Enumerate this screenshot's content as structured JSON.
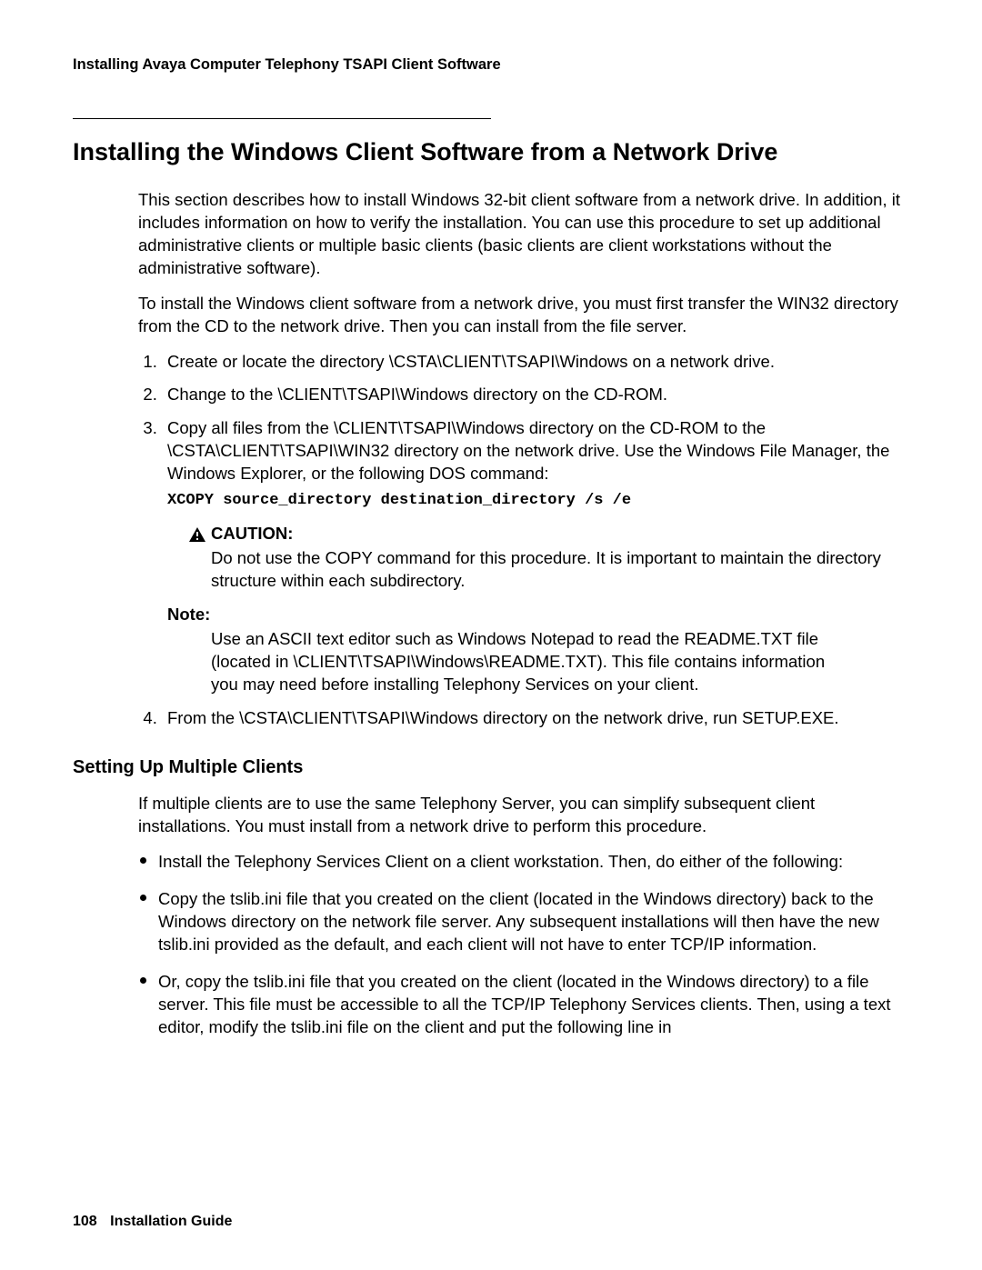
{
  "running_head": "Installing Avaya Computer Telephony TSAPI Client Software",
  "section_title": "Installing the Windows Client Software from a Network Drive",
  "intro_p1": "This section describes how to install Windows 32-bit client software from a network drive. In addition, it includes information on how to verify the installation. You can use this procedure to set up additional administrative clients or multiple basic clients (basic clients are client workstations without the administrative software).",
  "intro_p2": "To install the Windows client software from a network drive, you must first transfer the WIN32 directory from the CD to the network drive. Then you can install from the file server.",
  "steps": {
    "s1": "Create or locate the directory \\CSTA\\CLIENT\\TSAPI\\Windows on a network drive.",
    "s2": "Change to the \\CLIENT\\TSAPI\\Windows directory on the CD-ROM.",
    "s3": "Copy all files from the \\CLIENT\\TSAPI\\Windows directory on the CD-ROM to the \\CSTA\\CLIENT\\TSAPI\\WIN32 directory on the network drive. Use the Windows File Manager, the Windows Explorer, or the following DOS command:",
    "s3_code": "XCOPY source_directory destination_directory /s /e",
    "caution_label": "CAUTION:",
    "caution_body": "Do not use the COPY command for this procedure. It is important to maintain the directory structure within each subdirectory.",
    "note_label": "Note:",
    "note_body": "Use an ASCII text editor such as Windows Notepad to read the README.TXT file (located in \\CLIENT\\TSAPI\\Windows\\README.TXT). This file contains information you may need before installing Telephony Services on your client.",
    "s4": "From the \\CSTA\\CLIENT\\TSAPI\\Windows directory on the network drive, run SETUP.EXE."
  },
  "subsection_title": "Setting Up Multiple Clients",
  "sub_p1": "If multiple clients are to use the same Telephony Server, you can simplify subsequent client installations. You must install from a network drive to perform this procedure.",
  "bullets": {
    "b1": "Install the Telephony Services Client on a client workstation. Then, do either of the following:",
    "b2": "Copy the tslib.ini file that you created on the client (located in the Windows directory) back to the Windows directory on the network file server. Any subsequent installations will then have the new tslib.ini provided as the default, and each client will not have to enter TCP/IP information.",
    "b3": "Or, copy the tslib.ini file that you created on the client (located in the Windows directory) to a file server. This file must be accessible to all the TCP/IP Telephony Services clients. Then, using a text editor, modify the tslib.ini file on the client and put the following line in"
  },
  "footer": {
    "page_number": "108",
    "doc_title": "Installation Guide"
  }
}
